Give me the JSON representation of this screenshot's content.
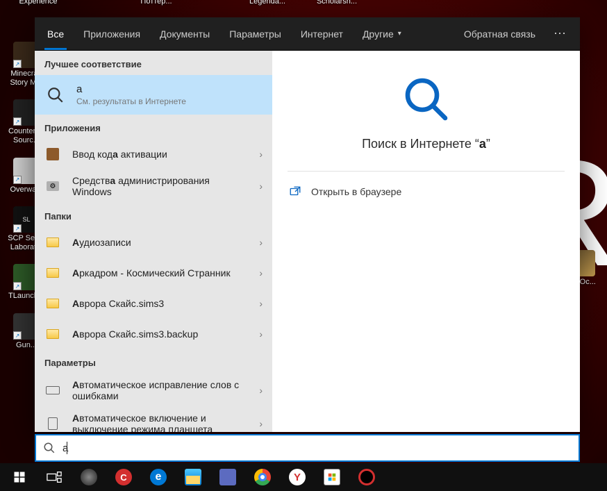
{
  "desktop": {
    "top_icons": [
      {
        "label": "Experience"
      },
      {
        "label": "Поттер..."
      },
      {
        "label": "Legenda..."
      },
      {
        "label": "Scholarsh..."
      }
    ],
    "left_icons": [
      {
        "label": "Minecraft Story M..."
      },
      {
        "label": "Counter-... Sourc..."
      },
      {
        "label": "Overwa..."
      },
      {
        "label": "SCP Sec... Laborat..."
      },
      {
        "label": "TLaunch..."
      },
      {
        "label": "Gun..."
      }
    ],
    "right_icon": {
      "label": "atYOc..."
    },
    "big_letter": "R"
  },
  "tabs": {
    "items": [
      {
        "label": "Все",
        "active": true
      },
      {
        "label": "Приложения"
      },
      {
        "label": "Документы"
      },
      {
        "label": "Параметры"
      },
      {
        "label": "Интернет"
      },
      {
        "label": "Другие",
        "dropdown": true
      }
    ],
    "feedback": "Обратная связь",
    "more": "⋯"
  },
  "results": {
    "best_match_header": "Лучшее соответствие",
    "best_match": {
      "title": "a",
      "subtitle": "См. результаты в Интернете"
    },
    "groups": [
      {
        "header": "Приложения",
        "items": [
          {
            "title_pre": "Ввод код",
            "title_bold": "а",
            "title_post": " активации",
            "icon": "cube"
          },
          {
            "title_pre": "Средств",
            "title_bold": "а",
            "title_post": " администрирования Windows",
            "icon": "tools"
          }
        ]
      },
      {
        "header": "Папки",
        "items": [
          {
            "title_bold": "А",
            "title_post": "удиозаписи",
            "icon": "folder"
          },
          {
            "title_bold": "А",
            "title_post": "ркадром - Космический Странник",
            "icon": "folder"
          },
          {
            "title_bold": "А",
            "title_post": "врора Скайс.sims3",
            "icon": "folder"
          },
          {
            "title_bold": "А",
            "title_post": "врора Скайс.sims3.backup",
            "icon": "folder"
          }
        ]
      },
      {
        "header": "Параметры",
        "items": [
          {
            "title_bold": "А",
            "title_post": "втоматическое исправление слов с ошибками",
            "icon": "keyboard"
          },
          {
            "title_bold": "А",
            "title_post": "втоматическое включение и выключение режима планшета",
            "icon": "tablet"
          }
        ]
      }
    ]
  },
  "preview": {
    "title_pre": "Поиск в Интернете ",
    "title_quote_open": "“",
    "title_query": "a",
    "title_quote_close": "”",
    "action": "Открыть в браузере"
  },
  "search": {
    "value": "a",
    "placeholder": ""
  },
  "taskbar": {
    "items": [
      "start",
      "task-view",
      "sound",
      "app-red",
      "edge",
      "explorer",
      "discord",
      "chrome",
      "yandex",
      "store",
      "record"
    ]
  }
}
